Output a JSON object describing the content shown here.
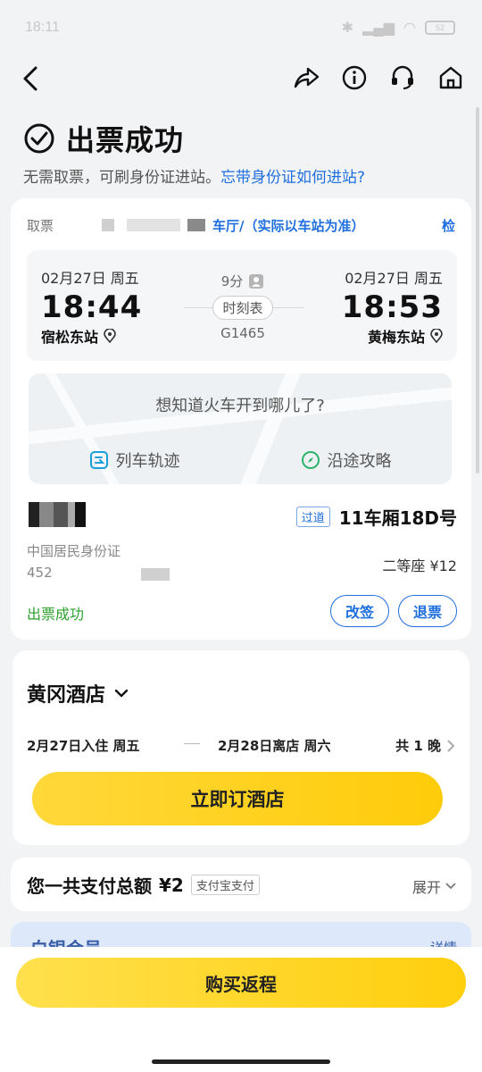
{
  "status_bar": {
    "time": "18:11",
    "battery": "52"
  },
  "header": {
    "title": "出票成功",
    "sub_text": "无需取票，可刷身份证进站。",
    "sub_link": "忘带身份证如何进站?"
  },
  "ticket": {
    "pickup_prefix": "取票",
    "pickup_hall": "车厅/（实际以车站为准）",
    "pickup_more": "检",
    "departure": {
      "date": "02月27日 周五",
      "time": "18:44",
      "station": "宿松东站"
    },
    "arrival": {
      "date": "02月27日 周五",
      "time": "18:53",
      "station": "黄梅东站"
    },
    "duration": "9分",
    "timetable_label": "时刻表",
    "train_no": "G1465",
    "map_question": "想知道火车开到哪儿了?",
    "map_actions": [
      "列车轨迹",
      "沿途攻略"
    ],
    "seat_tag": "过道",
    "seat_no": "11车厢18D号",
    "id_type": "中国居民身份证",
    "id_no_prefix": "452",
    "seat_class_price": "二等座 ¥12",
    "status": "出票成功",
    "change_label": "改签",
    "refund_label": "退票"
  },
  "hotel": {
    "name": "黄冈酒店",
    "checkin": "2月27日入住 周五",
    "checkout": "2月28日离店 周六",
    "nights": "共 1 晚",
    "book_label": "立即订酒店"
  },
  "payment": {
    "label": "您一共支付总额",
    "amount": "¥2",
    "method": "支付宝支付",
    "expand": "展开"
  },
  "member": {
    "label": "白银会员",
    "more": "详情"
  },
  "footer": {
    "return_label": "购买返程"
  },
  "colors": {
    "accent_blue": "#1f6fde",
    "success_green": "#2aa12a",
    "cta_yellow": "#ffd21a"
  }
}
